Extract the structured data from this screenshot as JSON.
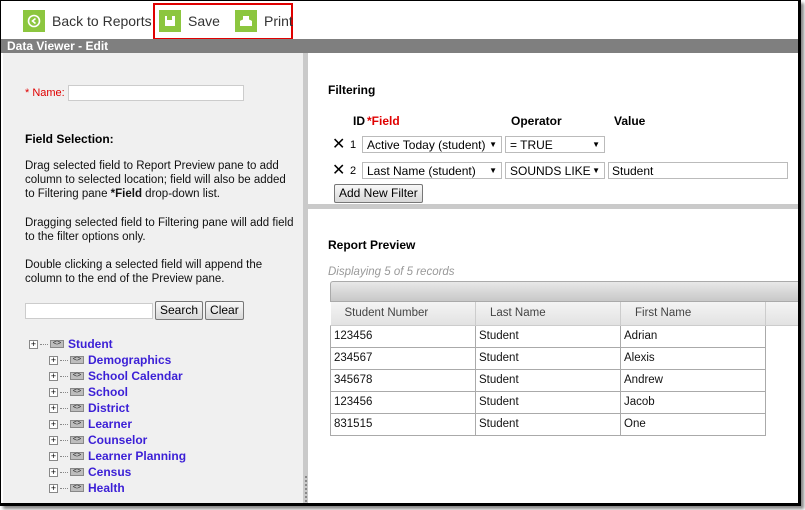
{
  "toolbar": {
    "back_label": "Back to Reports",
    "save_label": "Save",
    "print_label": "Print",
    "accent_color": "#8cc63f",
    "highlight_color": "#e00000"
  },
  "title_bar": "Data Viewer - Edit",
  "left_panel": {
    "name_required": "* Name:",
    "name_value": "",
    "field_selection_title": "Field Selection:",
    "para1_a": "Drag selected field to Report Preview pane to add column to selected location; field will also be added to Filtering pane ",
    "para1_bold": "*Field",
    "para1_b": " drop-down list.",
    "para2": "Dragging selected field to Filtering pane will add field to the filter options only.",
    "para3": "Double clicking a selected field will append the column to the end of the Preview pane.",
    "search_value": "",
    "search_label": "Search",
    "clear_label": "Clear",
    "tree_root": "Student",
    "tree_children": [
      "Demographics",
      "School Calendar",
      "School",
      "District",
      "Learner",
      "Counselor",
      "Learner Planning",
      "Census",
      "Health"
    ]
  },
  "filtering": {
    "title": "Filtering",
    "headers": {
      "id": "ID",
      "field": "*Field",
      "operator": "Operator",
      "value": "Value"
    },
    "rows": [
      {
        "id": "1",
        "field": "Active Today (student)",
        "operator": "= TRUE",
        "value": ""
      },
      {
        "id": "2",
        "field": "Last Name (student)",
        "operator": "SOUNDS LIKE",
        "value": "Student"
      }
    ],
    "add_label": "Add New Filter"
  },
  "preview": {
    "title": "Report Preview",
    "displaying": "Displaying 5 of 5 records",
    "columns": [
      "Student Number",
      "Last Name",
      "First Name"
    ],
    "rows": [
      [
        "123456",
        "Student",
        "Adrian"
      ],
      [
        "234567",
        "Student",
        "Alexis"
      ],
      [
        "345678",
        "Student",
        "Andrew"
      ],
      [
        "123456",
        "Student",
        "Jacob"
      ],
      [
        "831515",
        "Student",
        "One"
      ]
    ]
  }
}
